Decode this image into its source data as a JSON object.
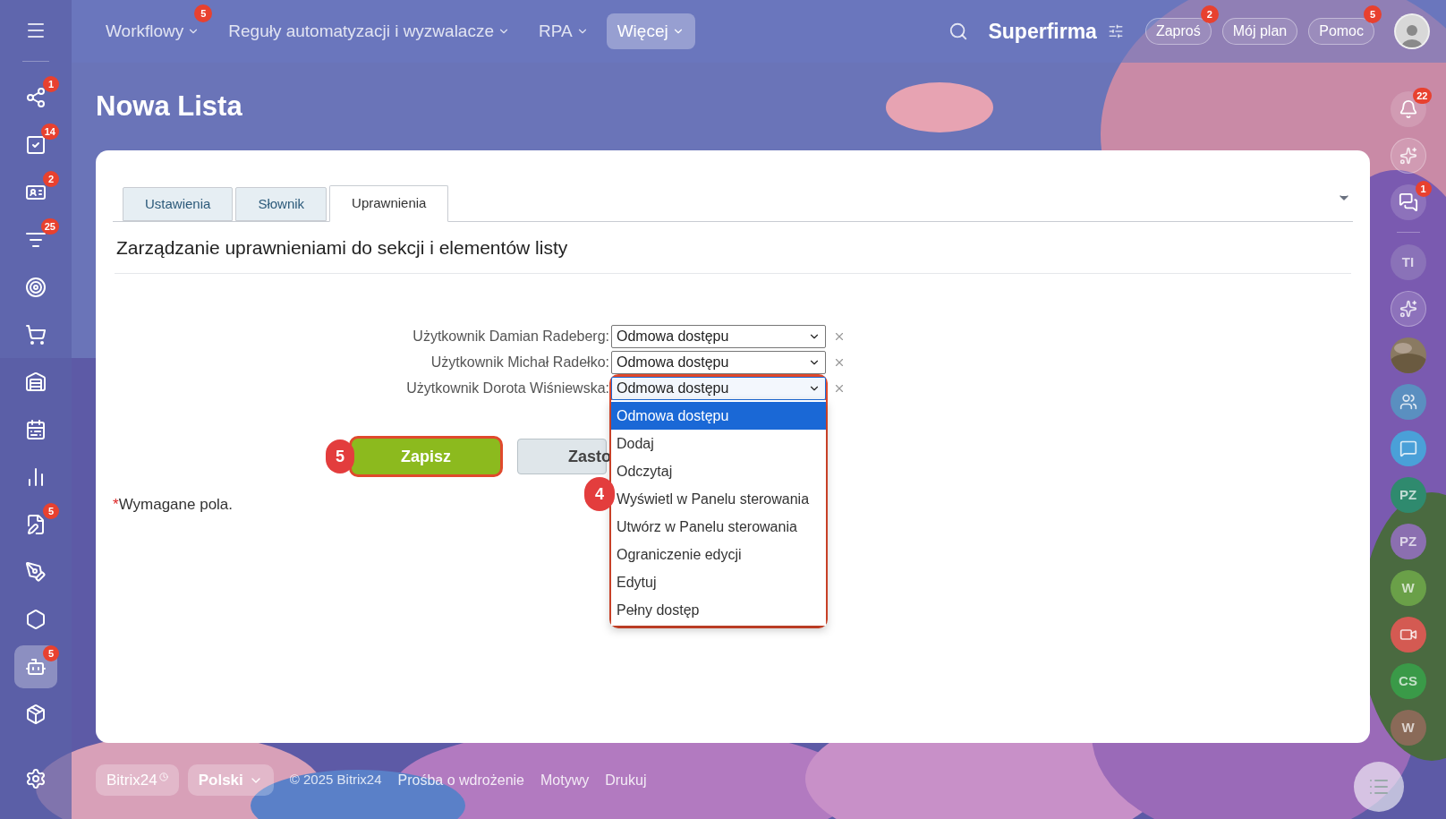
{
  "top_bar": {
    "nav": [
      {
        "label": "Workflowy",
        "badge": "5",
        "selected": false
      },
      {
        "label": "Reguły automatyzacji i wyzwalacze",
        "selected": false
      },
      {
        "label": "RPA",
        "selected": false
      },
      {
        "label": "Więcej",
        "selected": true
      }
    ],
    "company": "Superfirma",
    "buttons": [
      {
        "label": "Zaproś",
        "badge": "2"
      },
      {
        "label": "Mój plan"
      },
      {
        "label": "Pomoc",
        "badge": "5"
      }
    ]
  },
  "left_sidebar": {
    "items": [
      {
        "badge": "1",
        "selected": false
      },
      {
        "badge": "14",
        "selected": false
      },
      {
        "badge": "2",
        "selected": false
      },
      {
        "badge": "25",
        "selected": false
      },
      {
        "selected": false
      },
      {
        "selected": false
      },
      {
        "selected": false
      },
      {
        "selected": false
      },
      {
        "selected": false
      },
      {
        "badge": "5",
        "selected": false
      },
      {
        "selected": false
      },
      {
        "selected": false
      },
      {
        "badge": "5",
        "selected": true
      },
      {
        "selected": false
      }
    ]
  },
  "page_title": "Nowa Lista",
  "tabs": [
    {
      "label": "Ustawienia",
      "selected": false
    },
    {
      "label": "Słownik",
      "selected": false
    },
    {
      "label": "Uprawnienia",
      "selected": true
    }
  ],
  "section_heading": "Zarządzanie uprawnieniami do sekcji i elementów listy",
  "permissions": [
    {
      "label": "Użytkownik Damian Radeberg:",
      "value": "Odmowa dostępu",
      "open": false
    },
    {
      "label": "Użytkownik Michał Radełko:",
      "value": "Odmowa dostępu",
      "open": false
    },
    {
      "label": "Użytkownik Dorota Wiśniewska:",
      "value": "Odmowa dostępu",
      "open": true
    }
  ],
  "dropdown_options": [
    {
      "label": "Odmowa dostępu",
      "selected": true
    },
    {
      "label": "Dodaj",
      "selected": false
    },
    {
      "label": "Odczytaj",
      "selected": false
    },
    {
      "label": "Wyświetl w Panelu sterowania",
      "selected": false
    },
    {
      "label": "Utwórz w Panelu sterowania",
      "selected": false
    },
    {
      "label": "Ograniczenie edycji",
      "selected": false
    },
    {
      "label": "Edytuj",
      "selected": false
    },
    {
      "label": "Pełny dostęp",
      "selected": false
    }
  ],
  "buttons": {
    "save": "Zapisz",
    "apply": "Zasto"
  },
  "step_markers": {
    "save": "5",
    "dropdown": "4"
  },
  "required_note": {
    "mark": "*",
    "text": "Wymagane pola."
  },
  "footer": {
    "brand": "Bitrix24",
    "language": "Polski",
    "copyright": "© 2025 Bitrix24",
    "links": [
      "Prośba o wdrożenie",
      "Motywy",
      "Drukuj"
    ]
  },
  "right_rail": [
    {
      "kind": "bell",
      "badge": "22"
    },
    {
      "kind": "sparkle"
    },
    {
      "kind": "chat",
      "badge": "1"
    },
    {
      "kind": "initials",
      "text": "TI",
      "color": "#8a72b8"
    },
    {
      "kind": "sparkle"
    },
    {
      "kind": "picture"
    },
    {
      "kind": "group",
      "color": "#5a8fc0"
    },
    {
      "kind": "messages",
      "color": "#4aa0d8"
    },
    {
      "kind": "initials",
      "text": "PZ",
      "color": "#2f8a6e"
    },
    {
      "kind": "initials",
      "text": "PZ",
      "color": "#8b6fb0"
    },
    {
      "kind": "initials",
      "text": "W",
      "color": "#6aa048"
    },
    {
      "kind": "video",
      "color": "#d45a52"
    },
    {
      "kind": "initials",
      "text": "CS",
      "color": "#3a9a48"
    },
    {
      "kind": "initials",
      "text": "W",
      "color": "#8a6a58"
    }
  ]
}
